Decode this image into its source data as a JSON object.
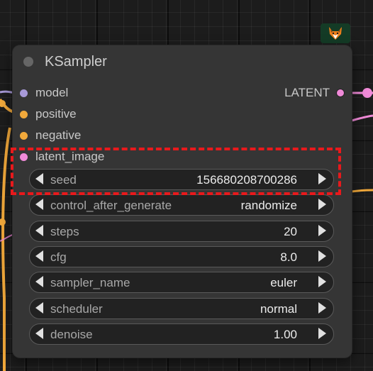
{
  "node": {
    "title": "KSampler",
    "inputs": [
      {
        "label": "model",
        "color": "#a89ad8"
      },
      {
        "label": "positive",
        "color": "#f2a93b"
      },
      {
        "label": "negative",
        "color": "#f2a93b"
      },
      {
        "label": "latent_image",
        "color": "#f08ad8"
      }
    ],
    "outputs": [
      {
        "label": "LATENT",
        "color": "#f08ad8"
      }
    ],
    "widgets": [
      {
        "label": "seed",
        "value": "156680208700286"
      },
      {
        "label": "control_after_generate",
        "value": "randomize"
      },
      {
        "label": "steps",
        "value": "20"
      },
      {
        "label": "cfg",
        "value": "8.0"
      },
      {
        "label": "sampler_name",
        "value": "euler"
      },
      {
        "label": "scheduler",
        "value": "normal"
      },
      {
        "label": "denoise",
        "value": "1.00"
      }
    ]
  },
  "badge": {
    "icon": "fox-icon"
  },
  "colors": {
    "node_bg": "#353535",
    "widget_bg": "#222222",
    "highlight": "#e8191c",
    "wire_yellow": "#f2a93b",
    "wire_pink": "#f08ad8",
    "wire_purple": "#a89ad8"
  }
}
